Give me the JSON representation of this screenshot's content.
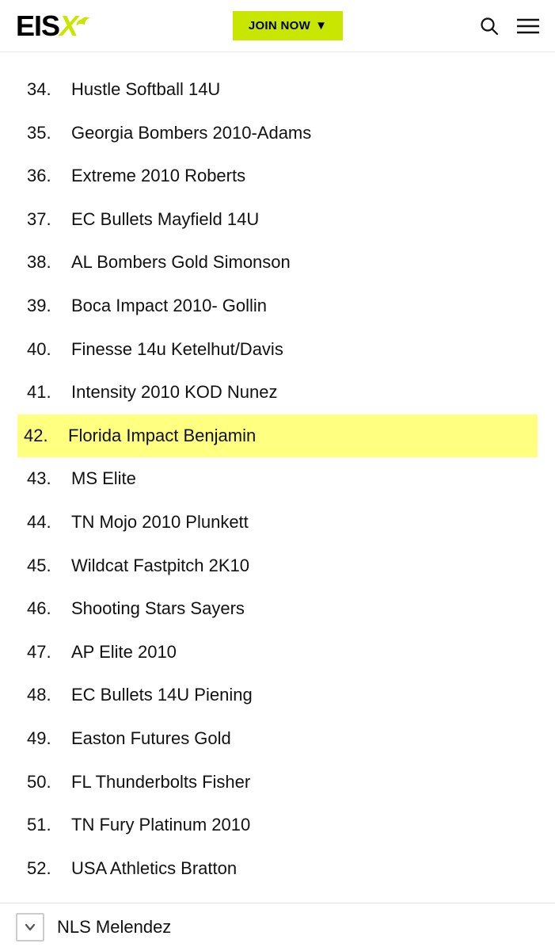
{
  "header": {
    "logo_main": "EIS",
    "logo_x": "X",
    "join_button": "JOIN NOW",
    "join_dropdown_arrow": "▼"
  },
  "list": {
    "items": [
      {
        "number": "34.",
        "name": "Hustle Softball 14U",
        "highlighted": false
      },
      {
        "number": "35.",
        "name": "Georgia Bombers 2010-Adams",
        "highlighted": false
      },
      {
        "number": "36.",
        "name": "Extreme 2010 Roberts",
        "highlighted": false
      },
      {
        "number": "37.",
        "name": "EC Bullets Mayfield 14U",
        "highlighted": false
      },
      {
        "number": "38.",
        "name": "AL Bombers Gold Simonson",
        "highlighted": false
      },
      {
        "number": "39.",
        "name": "Boca Impact 2010- Gollin",
        "highlighted": false
      },
      {
        "number": "40.",
        "name": "Finesse 14u Ketelhut/Davis",
        "highlighted": false
      },
      {
        "number": "41.",
        "name": "Intensity 2010 KOD Nunez",
        "highlighted": false
      },
      {
        "number": "42.",
        "name": "Florida Impact Benjamin",
        "highlighted": true
      },
      {
        "number": "43.",
        "name": "MS Elite",
        "highlighted": false
      },
      {
        "number": "44.",
        "name": "TN Mojo 2010 Plunkett",
        "highlighted": false
      },
      {
        "number": "45.",
        "name": "Wildcat Fastpitch 2K10",
        "highlighted": false
      },
      {
        "number": "46.",
        "name": "Shooting Stars Sayers",
        "highlighted": false
      },
      {
        "number": "47.",
        "name": "AP Elite 2010",
        "highlighted": false
      },
      {
        "number": "48.",
        "name": "EC Bullets 14U Piening",
        "highlighted": false
      },
      {
        "number": "49.",
        "name": "Easton Futures Gold",
        "highlighted": false
      },
      {
        "number": "50.",
        "name": "FL Thunderbolts Fisher",
        "highlighted": false
      },
      {
        "number": "51.",
        "name": "TN Fury Platinum 2010",
        "highlighted": false
      },
      {
        "number": "52.",
        "name": "USA Athletics Bratton",
        "highlighted": false
      }
    ],
    "bottom_item": "NLS Melendez"
  }
}
